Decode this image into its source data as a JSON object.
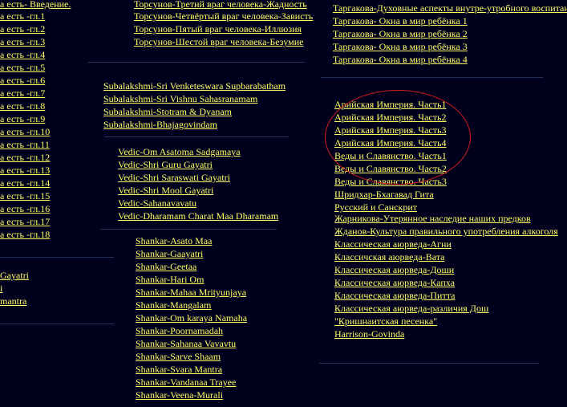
{
  "left_column": {
    "chapters": [
      "а есть- Введение.",
      "а есть -гл.1",
      "а есть -гл.2",
      "а есть -гл.3",
      "а есть -гл.4",
      "а есть -гл.5",
      "а есть -гл.6",
      "а есть -гл.7",
      "а есть -гл.8",
      "а есть -гл.9",
      "а есть -гл.10",
      "а есть -гл.11",
      "а есть -гл.12",
      "а есть -гл.13",
      "а есть -гл.14",
      "а есть -гл.15",
      "а есть -гл.16",
      "а есть -гл.17",
      "а есть -гл.18"
    ],
    "extras": [
      "Gayatri",
      "i",
      "mantra"
    ]
  },
  "torsunov": [
    "Торсунов-Третий враг человека-Жадность",
    "Торсунов-Четвёртый враг человека-Зависть",
    "Торсунов-Пятый враг человека-Иллюзия",
    "Торсунов-Шестой враг человека-Безумие"
  ],
  "subalakshmi": [
    "Subalakshmi-Sri Venketeswara Supbarabatham",
    "Subalakshmi-Sri Vishnu Sahasranamam",
    "Subalakshmi-Stotram & Dyanam",
    "Subalakshmi-Bhajagovindam"
  ],
  "vedic": [
    "Vedic-Om Asatoma Sadgamaya",
    "Vedic-Shri Guru Gayatri",
    "Vedic-Shri Saraswati Gayatri",
    "Vedic-Shri Mool Gayatri",
    "Vedic-Sahanavavatu",
    "Vedic-Dharamam Charat Maa Dharamam"
  ],
  "shankar": [
    "Shankar-Asato Maa",
    "Shankar-Gaayatri",
    "Shankar-Geetaa",
    "Shankar-Hari Om",
    "Shankar-Mahaa Mrityunjaya",
    "Shankar-Mangalam",
    "Shankar-Om karaya Namaha",
    "Shankar-Poornamadah",
    "Shankar-Sahanaa Vavavtu",
    "Shankar-Sarve Shaam",
    "Shankar-Svara Mantra",
    "Shankar-Vandanaa Trayee",
    "Shankar-Veena-Murali"
  ],
  "targakova": [
    "Таргакова-Духовные аспекты внутре-утробного воспитания",
    "Таргакова- Окна в мир ребёнка 1",
    "Таргакова- Окна в мир ребёнка 2",
    "Таргакова- Окна в мир ребёнка 3",
    "Таргакова- Окна в мир ребёнка 4"
  ],
  "right_list": [
    "Арийская Империя. Часть1",
    "Арийская Империя. Часть2",
    "Арийская Империя. Часть3",
    "Арийская Империя. Часть4",
    "Веды и Славянство. Часть1",
    "Веды и Славянство. Часть2",
    "Веды и Славянство. Часть3",
    "Шридхар-Бхагавад Гита",
    "Русский и Санскрит",
    "Жарникова-Утерянное наследие наших предков",
    "Жданов-Культура правильного употребления алкоголя",
    "Классическая аюрведа-Агни",
    "Классичская аюрведа-Вата",
    "Классическая аюрведа-Доши",
    "Классическая аюрведа-Капха",
    "Классическая аюрведа-Питта",
    "Классическая аюрведа-различия Дош",
    "\"Кришнаитская песенка\"",
    "Harrison-Govinda"
  ],
  "colors": {
    "background": "#00001d",
    "link": "#ffff66",
    "annotation_oval": "#d21e1e"
  }
}
